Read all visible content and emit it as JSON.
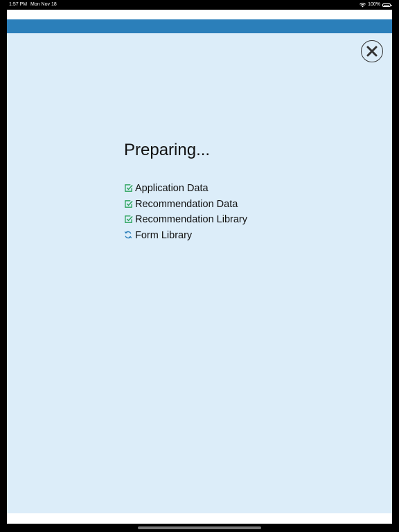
{
  "status_bar": {
    "time": "1:57 PM",
    "date": "Mon Nov 18",
    "battery_text": "100%",
    "battery_level": 1.0,
    "icons": [
      "wifi-icon",
      "battery-icon"
    ]
  },
  "dialog": {
    "title": "Preparing...",
    "close_icon": "close-icon",
    "items": [
      {
        "label": "Application Data",
        "status": "done",
        "icon": "checkbox-checked-icon"
      },
      {
        "label": "Recommendation Data",
        "status": "done",
        "icon": "checkbox-checked-icon"
      },
      {
        "label": "Recommendation Library",
        "status": "done",
        "icon": "checkbox-checked-icon"
      },
      {
        "label": "Form Library",
        "status": "in-progress",
        "icon": "sync-icon"
      }
    ]
  },
  "colors": {
    "header_bar": "#2b7fba",
    "background": "#dcedf9",
    "check_green": "#2aa35b",
    "sync_blue": "#2b7fba"
  }
}
